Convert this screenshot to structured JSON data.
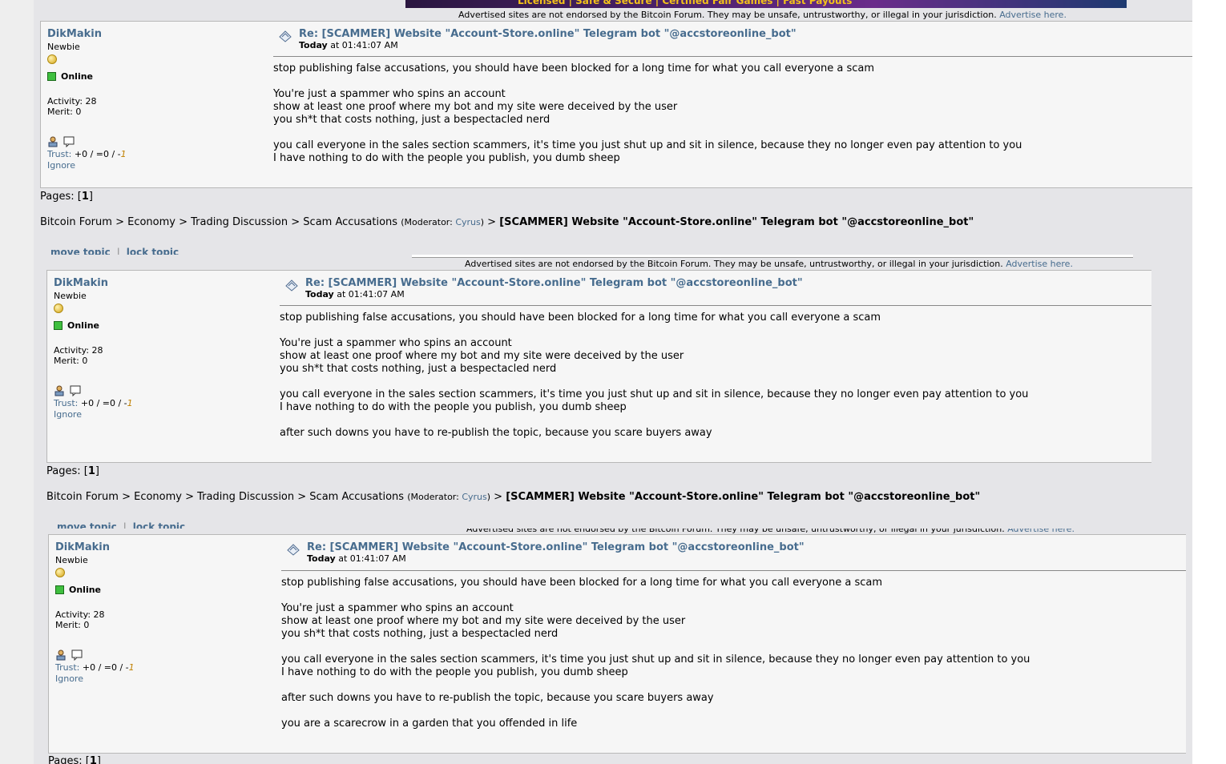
{
  "ad_notice": "Advertised sites are not endorsed by the Bitcoin Forum. They may be unsafe, untrustworthy, or illegal in your jurisdiction.",
  "advertise_link": "Advertise here.",
  "banner_text": "Licensed | Safe & Secure | Certified Fair Games | Fast Payouts",
  "poster": {
    "name": "DikMakin",
    "rank": "Newbie",
    "status": "Online",
    "activity": "Activity: 28",
    "merit": "Merit: 0",
    "trust_label": "Trust:",
    "trust_pos": " +0 / =0 / -",
    "trust_neg": "1",
    "ignore": "Ignore"
  },
  "post": {
    "subject": "Re: [SCAMMER] Website \"Account-Store.online\" Telegram bot \"@accstoreonline_bot\"",
    "time_day": "Today",
    "time_rest": " at 01:41:07 AM"
  },
  "lines": [
    "stop publishing false accusations, you should have been blocked for a long time for what you call everyone a scam",
    "You're just a spammer who spins an account",
    "show at least one proof where my bot and my site were deceived by the user",
    "you sh*t that costs nothing, just a bespectacled nerd",
    "you call everyone in the sales section scammers, it's time you just shut up and sit in silence, because they no longer even pay attention to you",
    "I have nothing to do with the people you publish, you dumb sheep",
    "after such downs you have to re-publish the topic, because you scare buyers away",
    "you are a scarecrow in a garden that you offended in life"
  ],
  "pages": {
    "label": "Pages: [",
    "current": "1",
    "close": "]"
  },
  "breadcrumb": {
    "forum": "Bitcoin Forum",
    "board1": "Economy",
    "board2": "Trading Discussion",
    "board3": "Scam Accusations",
    "moderator_label": "Moderator: ",
    "moderator": "Cyrus",
    "topic": "[SCAMMER] Website \"Account-Store.online\" Telegram bot \"@accstoreonline_bot\""
  },
  "mod_actions": {
    "move": "move topic",
    "lock": "lock topic"
  }
}
